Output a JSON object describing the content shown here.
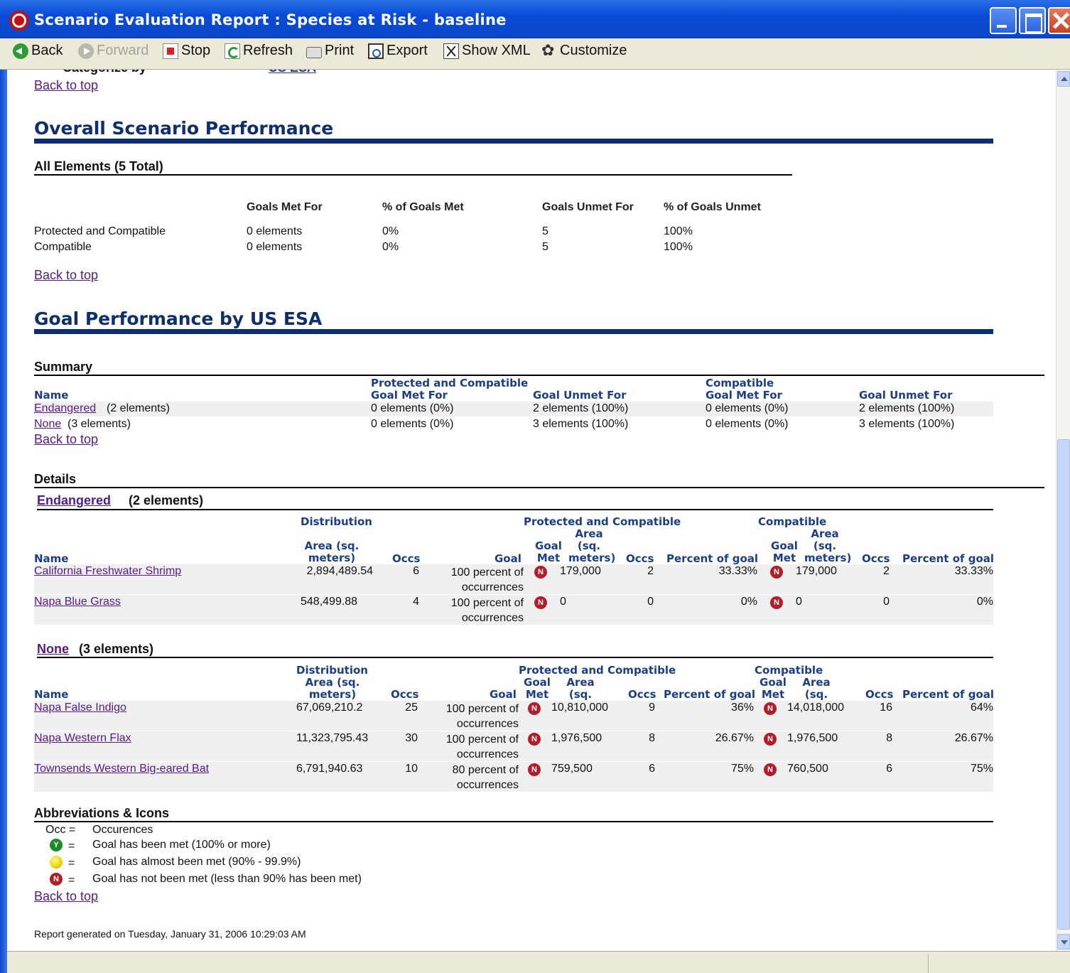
{
  "window": {
    "title": "Scenario Evaluation Report : Species at Risk - baseline"
  },
  "toolbar": {
    "back": "Back",
    "forward": "Forward",
    "stop": "Stop",
    "refresh": "Refresh",
    "print": "Print",
    "export": "Export",
    "show_xml": "Show XML",
    "customize": "Customize"
  },
  "top": {
    "cut_label": "Categorize by",
    "cut_link": "US ESA",
    "back_to_top": "Back to top"
  },
  "overall": {
    "title": "Overall Scenario Performance",
    "subtitle": "All Elements (5 Total)",
    "columns": [
      "Goals Met For",
      "% of Goals Met",
      "Goals Unmet For",
      "% of Goals Unmet"
    ],
    "rows": [
      {
        "label": "Protected and Compatible",
        "met": "0 elements",
        "pct_met": "0%",
        "unmet": "5",
        "pct_unmet": "100%"
      },
      {
        "label": "Compatible",
        "met": "0 elements",
        "pct_met": "0%",
        "unmet": "5",
        "pct_unmet": "100%"
      }
    ],
    "back_to_top": "Back to top"
  },
  "goal_performance": {
    "title": "Goal Performance by US ESA",
    "summary": {
      "title": "Summary",
      "group_pc": "Protected and Compatible",
      "group_c": "Compatible",
      "col_name": "Name",
      "col_met": "Goal Met For",
      "col_unmet": "Goal Unmet For",
      "rows": [
        {
          "name": "Endangered",
          "count": "(2 elements)",
          "pc_met": "0 elements (0%)",
          "pc_unmet": "2 elements (100%)",
          "c_met": "0 elements (0%)",
          "c_unmet": "2 elements (100%)"
        },
        {
          "name": "None",
          "count": "(3 elements)",
          "pc_met": "0 elements (0%)",
          "pc_unmet": "3 elements (100%)",
          "c_met": "0 elements (0%)",
          "c_unmet": "3 elements (100%)"
        }
      ],
      "back_to_top": "Back to top"
    },
    "details": {
      "title": "Details",
      "headers": {
        "distribution": "Distribution",
        "protected_compatible": "Protected and Compatible",
        "compatible": "Compatible",
        "name": "Name",
        "area": "Area (sq. meters)",
        "occs": "Occs",
        "goal": "Goal",
        "goal_met": "Goal Met",
        "percent_of_goal": "Percent of goal"
      },
      "groups": [
        {
          "name": "Endangered",
          "count": "(2 elements)",
          "rows": [
            {
              "name": "California Freshwater Shrimp",
              "dist_area": "2,894,489.54",
              "dist_occs": "6",
              "goal": "100 percent of occurrences",
              "pc_area": "179,000",
              "pc_occs": "2",
              "pc_pct": "33.33%",
              "c_area": "179,000",
              "c_occs": "2",
              "c_pct": "33.33%"
            },
            {
              "name": "Napa Blue Grass",
              "dist_area": "548,499.88",
              "dist_occs": "4",
              "goal": "100 percent of occurrences",
              "pc_area": "0",
              "pc_occs": "0",
              "pc_pct": "0%",
              "c_area": "0",
              "c_occs": "0",
              "c_pct": "0%"
            }
          ]
        },
        {
          "name": "None",
          "count": "(3 elements)",
          "rows": [
            {
              "name": "Napa False Indigo",
              "dist_area": "67,069,210.2",
              "dist_occs": "25",
              "goal": "100 percent of occurrences",
              "pc_area": "10,810,000",
              "pc_occs": "9",
              "pc_pct": "36%",
              "c_area": "14,018,000",
              "c_occs": "16",
              "c_pct": "64%"
            },
            {
              "name": "Napa Western Flax",
              "dist_area": "11,323,795.43",
              "dist_occs": "30",
              "goal": "100 percent of occurrences",
              "pc_area": "1,976,500",
              "pc_occs": "8",
              "pc_pct": "26.67%",
              "c_area": "1,976,500",
              "c_occs": "8",
              "c_pct": "26.67%"
            },
            {
              "name": "Townsends Western Big-eared Bat",
              "dist_area": "6,791,940.63",
              "dist_occs": "10",
              "goal": "80 percent of occurrences",
              "pc_area": "759,500",
              "pc_occs": "6",
              "pc_pct": "75%",
              "c_area": "760,500",
              "c_occs": "6",
              "c_pct": "75%"
            }
          ]
        }
      ]
    }
  },
  "abbreviations": {
    "title": "Abbreviations & Icons",
    "occ_key": "Occ =",
    "occ_value": "Occurences",
    "eq": "=",
    "met": "Goal has been met (100% or more)",
    "almost": "Goal has almost been met (90% - 99.9%)",
    "not_met": "Goal has not been met (less than 90% has been met)",
    "icons": [
      "goal-met-icon",
      "goal-almost-met-icon",
      "goal-not-met-icon"
    ],
    "back_to_top": "Back to top"
  },
  "footer": {
    "generated": "Report generated on Tuesday, January 31, 2006 10:29:03 AM"
  },
  "colors": {
    "heading": "#0d2f6d",
    "column_header": "#1b3e86",
    "not_met_icon": "#b51c2a",
    "met_icon": "#1d8a2a",
    "almost_icon": "#e8d400"
  }
}
